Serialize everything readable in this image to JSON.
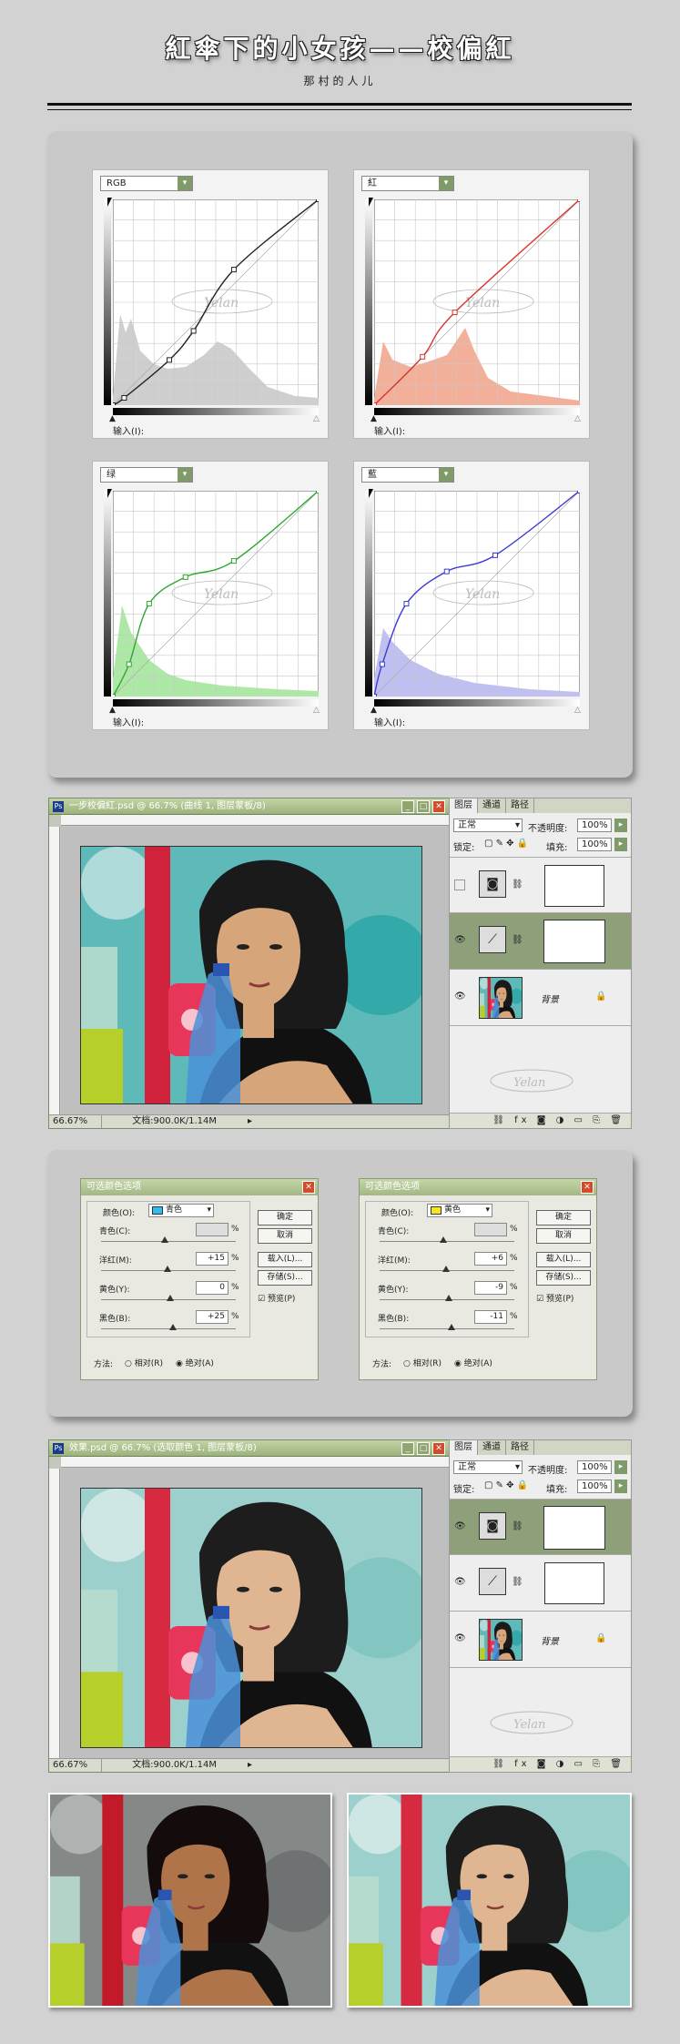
{
  "header": {
    "title": "紅傘下的小女孩——校偏紅",
    "author": "那村的人儿"
  },
  "curves": [
    {
      "channel": "RGB",
      "color": "#222222",
      "hist": "#cfcfcf",
      "points": [
        [
          0,
          0
        ],
        [
          14,
          9
        ],
        [
          70,
          56
        ],
        [
          100,
          92
        ],
        [
          150,
          168
        ],
        [
          255,
          255
        ]
      ],
      "input_label": "输入(I):"
    },
    {
      "channel": "紅",
      "color": "#d9342b",
      "hist": "#f2b09a",
      "points": [
        [
          0,
          0
        ],
        [
          60,
          60
        ],
        [
          100,
          115
        ],
        [
          255,
          255
        ]
      ],
      "input_label": "输入(I):"
    },
    {
      "channel": "绿",
      "color": "#2ea82e",
      "hist": "#aee8a6",
      "points": [
        [
          0,
          0
        ],
        [
          20,
          40
        ],
        [
          45,
          115
        ],
        [
          90,
          148
        ],
        [
          150,
          168
        ],
        [
          255,
          255
        ]
      ],
      "input_label": "输入(I):"
    },
    {
      "channel": "藍",
      "color": "#3a3ad6",
      "hist": "#c0c0f0",
      "points": [
        [
          0,
          0
        ],
        [
          10,
          40
        ],
        [
          40,
          115
        ],
        [
          90,
          155
        ],
        [
          150,
          175
        ],
        [
          255,
          255
        ]
      ],
      "input_label": "输入(I):"
    }
  ],
  "watermark": "Yelan",
  "ps_window_1": {
    "title": "一步校偏紅.psd @ 66.7% (曲线 1, 图层蒙板/8)",
    "zoom": "66.67%",
    "doc_info": "文档:900.0K/1.14M"
  },
  "ps_window_2": {
    "title": "效果.psd @ 66.7% (选取颜色 1, 图层蒙板/8)",
    "zoom": "66.67%",
    "doc_info": "文档:900.0K/1.14M"
  },
  "layers_panel": {
    "tabs": [
      "图层",
      "通道",
      "路径"
    ],
    "blend_mode": "正常",
    "opacity_label": "不透明度:",
    "opacity_value": "100%",
    "lock_label": "锁定:",
    "fill_label": "填充:",
    "fill_value": "100%",
    "bg_layer_name": "背景"
  },
  "selective_color_1": {
    "title": "可选颜色选项",
    "color_label": "颜色(O):",
    "color_value": "青色",
    "swatch": "#33bbee",
    "fields": [
      {
        "label": "青色(C):",
        "value": "",
        "pct": "%"
      },
      {
        "label": "洋红(M):",
        "value": "+15",
        "pct": "%"
      },
      {
        "label": "黄色(Y):",
        "value": "0",
        "pct": "%"
      },
      {
        "label": "黑色(B):",
        "value": "+25",
        "pct": "%"
      }
    ],
    "buttons": [
      "确定",
      "取消",
      "载入(L)...",
      "存储(S)..."
    ],
    "preview_label": "预览(P)",
    "method_label": "方法:",
    "method_relative": "相对(R)",
    "method_absolute": "绝对(A)"
  },
  "selective_color_2": {
    "title": "可选颜色选项",
    "color_label": "颜色(O):",
    "color_value": "黄色",
    "swatch": "#f5e623",
    "fields": [
      {
        "label": "青色(C):",
        "value": "",
        "pct": "%"
      },
      {
        "label": "洋红(M):",
        "value": "+6",
        "pct": "%"
      },
      {
        "label": "黄色(Y):",
        "value": "-9",
        "pct": "%"
      },
      {
        "label": "黑色(B):",
        "value": "-11",
        "pct": "%"
      }
    ],
    "buttons": [
      "确定",
      "取消",
      "载入(L)...",
      "存储(S)..."
    ],
    "preview_label": "预览(P)",
    "method_label": "方法:",
    "method_relative": "相对(R)",
    "method_absolute": "绝对(A)"
  }
}
